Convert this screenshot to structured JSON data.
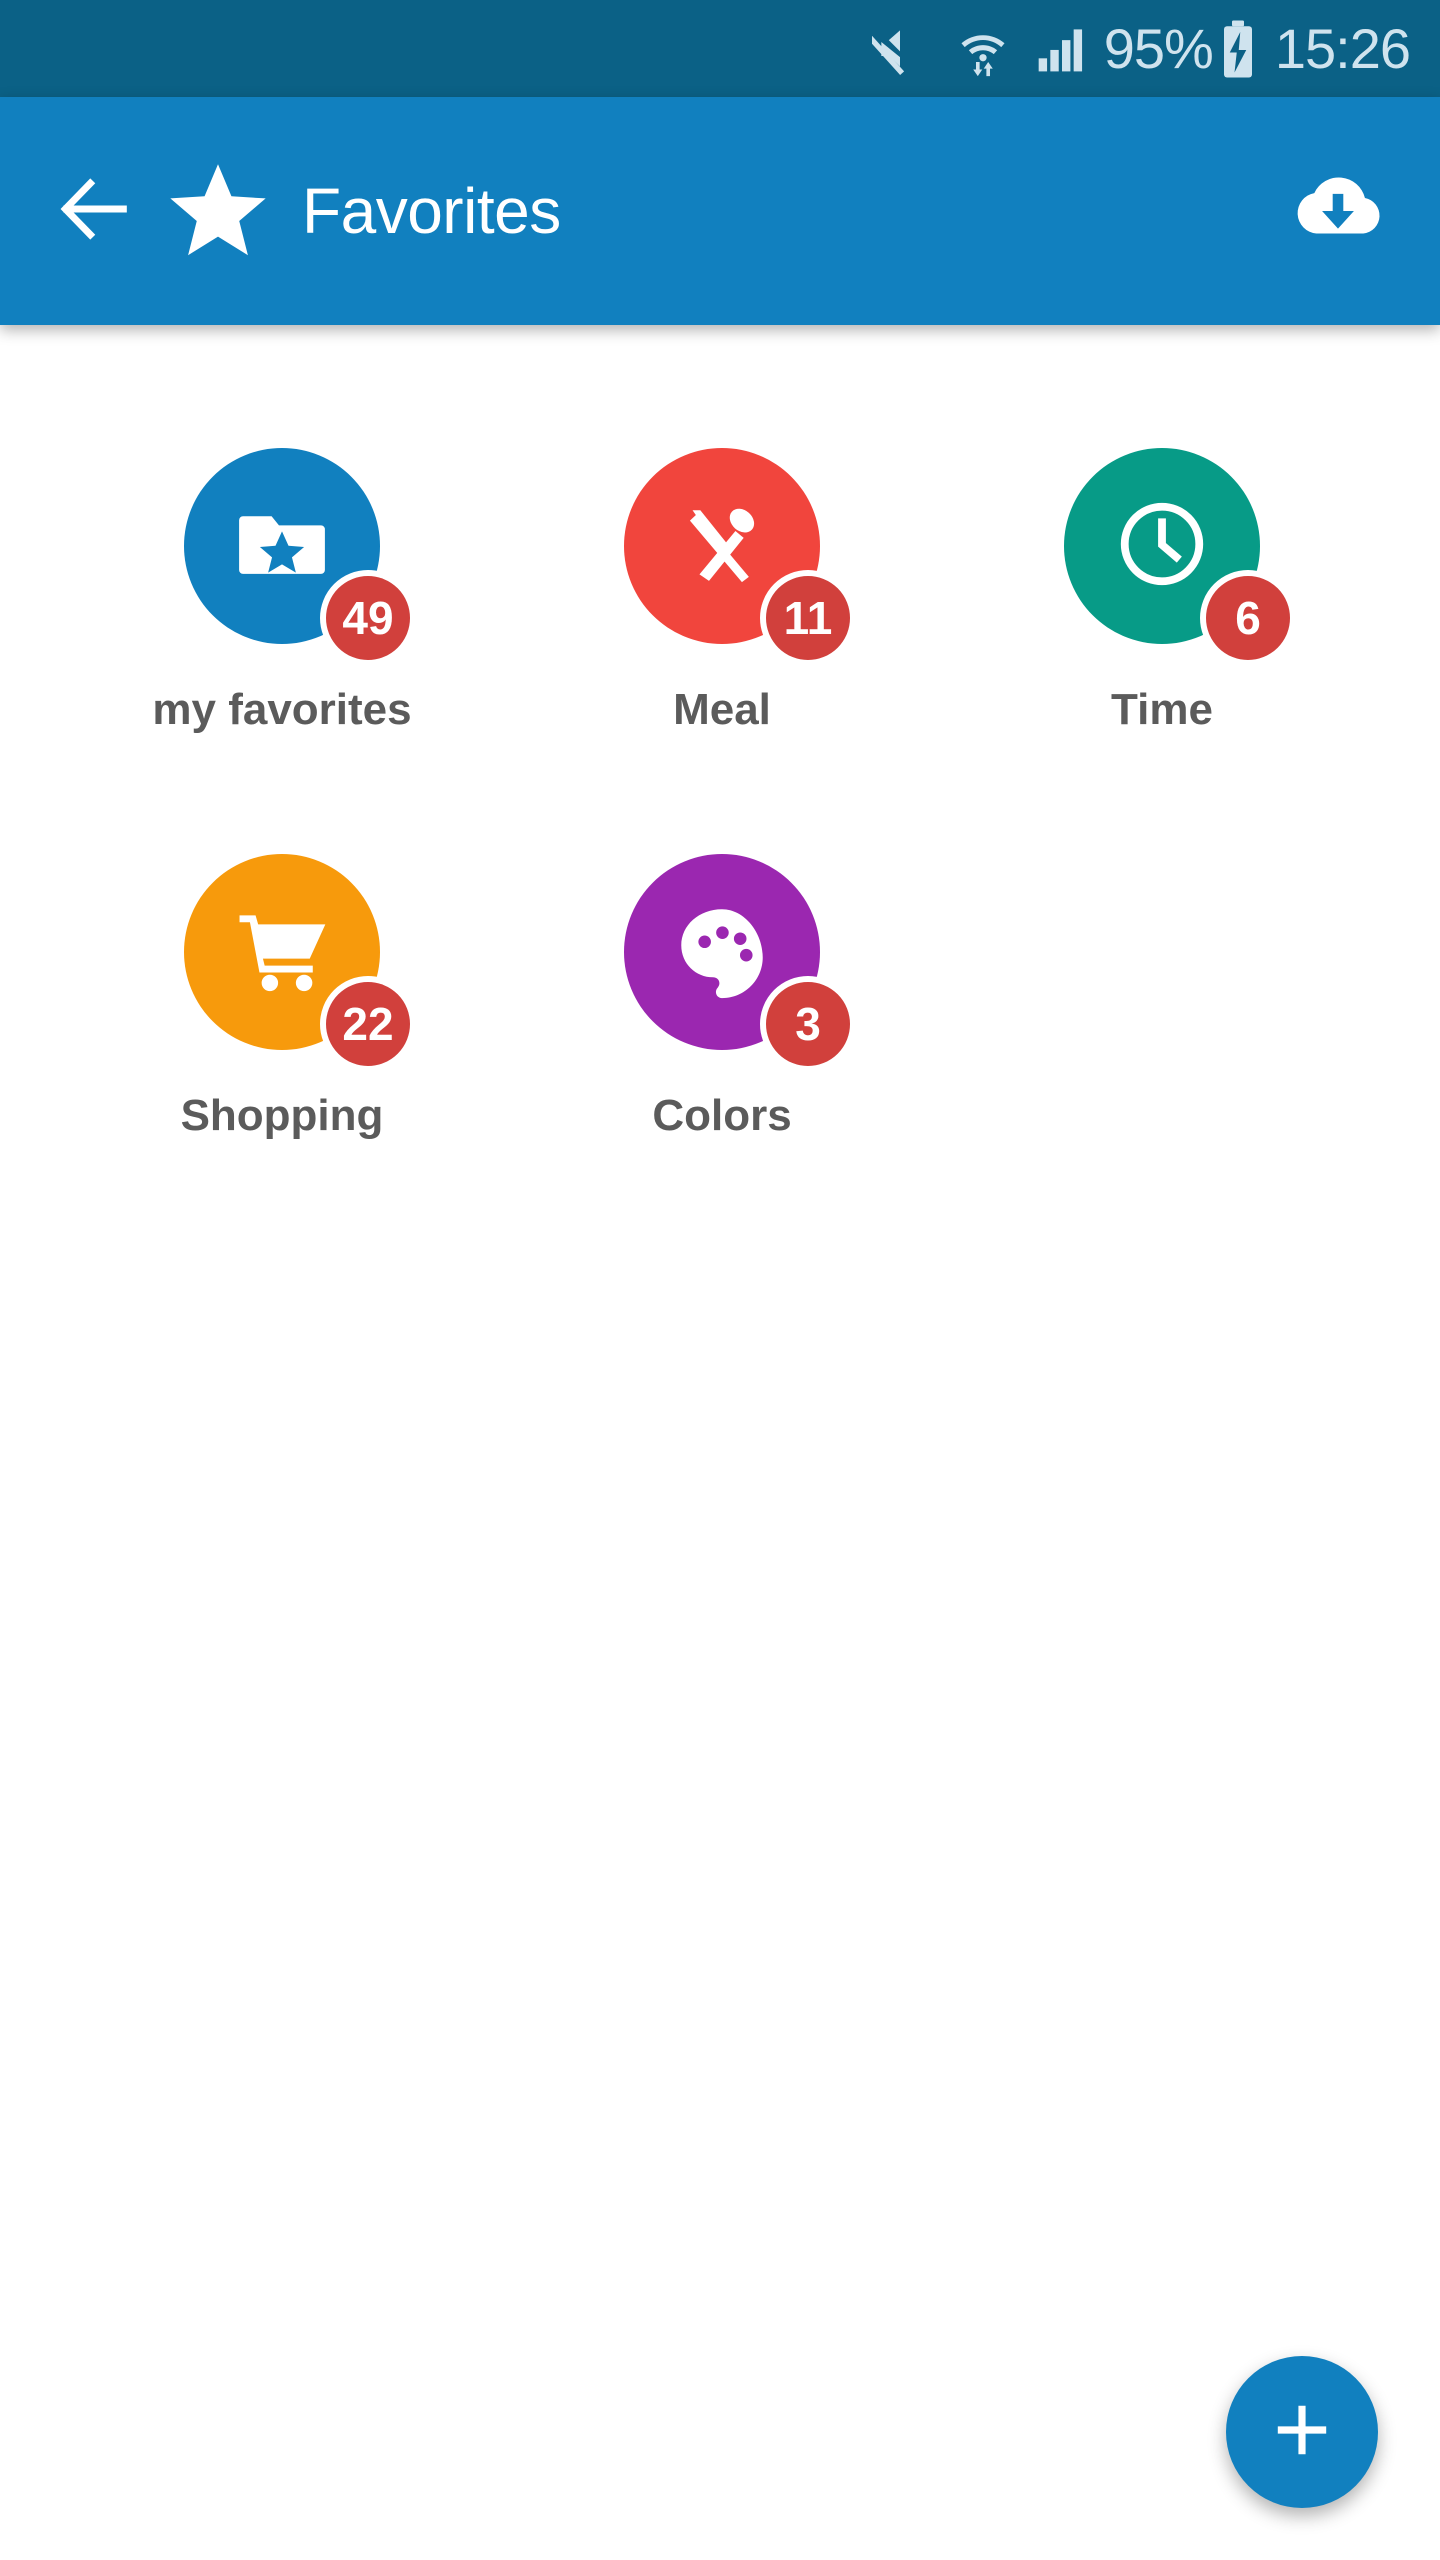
{
  "status_bar": {
    "mute_icon": "mute-icon",
    "wifi_icon": "wifi-data-icon",
    "signal_icon": "signal-bars-icon",
    "battery_percent": "95%",
    "battery_icon": "battery-charging-icon",
    "clock": "15:26",
    "background_color": "#0b6186",
    "text_color": "#cfe3ee"
  },
  "app_bar": {
    "back_icon": "back-arrow-icon",
    "star_icon": "star-icon",
    "title": "Favorites",
    "cloud_download_icon": "cloud-download-icon",
    "background_color": "#1180bf"
  },
  "categories": [
    {
      "label": "my favorites",
      "badge": "49",
      "color": "#1180bf",
      "icon": "folder-star-icon"
    },
    {
      "label": "Meal",
      "badge": "11",
      "color": "#f1453d",
      "icon": "cutlery-icon"
    },
    {
      "label": "Time",
      "badge": "6",
      "color": "#079b87",
      "icon": "clock-icon"
    },
    {
      "label": "Shopping",
      "badge": "22",
      "color": "#f79a0c",
      "icon": "shopping-cart-icon"
    },
    {
      "label": "Colors",
      "badge": "3",
      "color": "#9b27b0",
      "icon": "palette-icon"
    }
  ],
  "fab": {
    "icon": "plus-icon",
    "color": "#1180bf"
  },
  "badge_color": "#d1403c",
  "label_color": "#5b5b5b"
}
